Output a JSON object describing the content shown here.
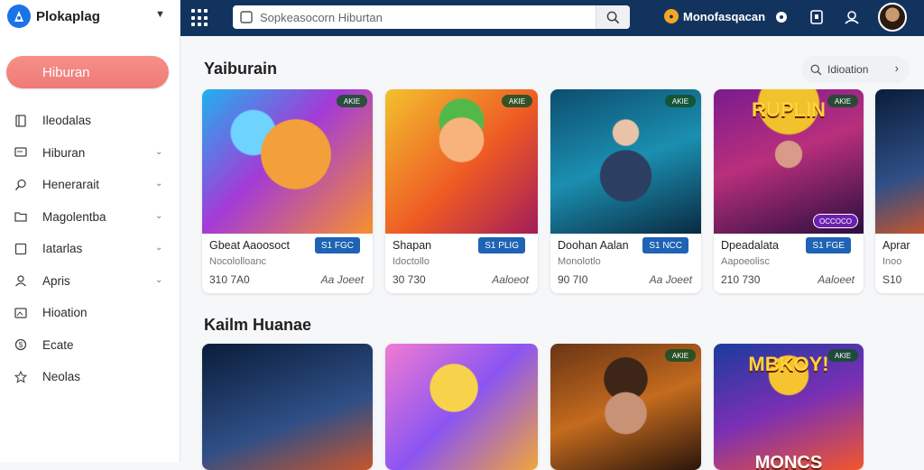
{
  "brand": {
    "name": "Plokaplag"
  },
  "sidebar": {
    "primary_button": "Hiburan",
    "items": [
      {
        "label": "Ileodalas",
        "icon": "bookmark-icon",
        "chevron": false
      },
      {
        "label": "Hiburan",
        "icon": "monitor-icon",
        "chevron": true
      },
      {
        "label": "Henerarait",
        "icon": "search-icon",
        "chevron": true
      },
      {
        "label": "Magolentba",
        "icon": "folder-icon",
        "chevron": true
      },
      {
        "label": "Iatarlas",
        "icon": "square-icon",
        "chevron": true
      },
      {
        "label": "Apris",
        "icon": "user-icon",
        "chevron": true
      },
      {
        "label": "Hioation",
        "icon": "image-icon",
        "chevron": false
      },
      {
        "label": "Ecate",
        "icon": "coin-icon",
        "chevron": false
      },
      {
        "label": "Neolas",
        "icon": "star-icon",
        "chevron": false
      }
    ]
  },
  "topbar": {
    "search_placeholder": "Sopkeasocorn Hiburtan",
    "app_brand": "Monofasqacan"
  },
  "section1": {
    "title": "Yaiburain",
    "filter_label": "Idioation",
    "cards": [
      {
        "title": "Gbeat Aaoosoct",
        "subtitle": "Nocololloanc",
        "count": "310 7A0",
        "action": "Aa Joeet",
        "price": "S1 FGC",
        "badge": "AKIE",
        "art": "art1"
      },
      {
        "title": "Shapan",
        "subtitle": "Idoctollo",
        "count": "30 730",
        "action": "Aaloeot",
        "price": "S1 PLIG",
        "badge": "AKIE",
        "art": "art2"
      },
      {
        "title": "Doohan Aalan",
        "subtitle": "Monolotlo",
        "count": "90 7I0",
        "action": "Aa Joeet",
        "price": "S1 NCC",
        "badge": "AKIE",
        "art": "art3"
      },
      {
        "title": "Dpeadalata",
        "subtitle": "Aapoeolisc",
        "count": "210 730",
        "action": "Aaloeet",
        "price": "S1 FGE",
        "badge": "AKIE",
        "art": "art4",
        "overlay": "RUPLIN",
        "tag": "OCCOCO"
      },
      {
        "title": "Aprar",
        "subtitle": "Inoo",
        "count": "S10",
        "action": "",
        "price": "",
        "badge": "",
        "art": "art5"
      }
    ]
  },
  "section2": {
    "title": "Kailm Huanae",
    "cards": [
      {
        "art": "art5",
        "badge": ""
      },
      {
        "art": "art6",
        "badge": ""
      },
      {
        "art": "art7",
        "badge": "AKIE"
      },
      {
        "art": "art8",
        "badge": "AKIE",
        "overlay": "MBKOY!",
        "overlay2": "MONCS"
      }
    ]
  }
}
